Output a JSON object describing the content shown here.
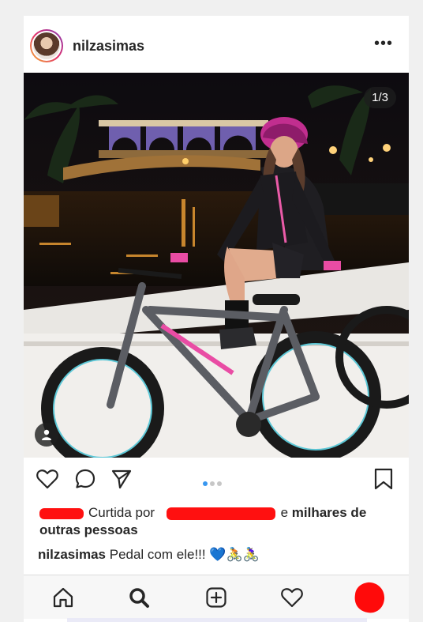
{
  "post": {
    "username": "nilzasimas",
    "more_label": "•••",
    "counter": "1/3",
    "carousel_dots": 3,
    "active_dot": 1
  },
  "likes": {
    "prefix": "Curtida por",
    "connector": "e",
    "suffix_bold": "milhares de outras pessoas"
  },
  "caption": {
    "username": "nilzasimas",
    "text": "Pedal com ele!!! 💙🚴🚴‍♀️"
  },
  "icons": {
    "like": "heart-icon",
    "comment": "comment-icon",
    "share": "send-icon",
    "save": "bookmark-icon",
    "home": "home-icon",
    "search": "search-icon",
    "new_post": "plus-square-icon",
    "activity": "heart-icon",
    "profile": "avatar-icon"
  },
  "colors": {
    "accent_blue": "#3897f0",
    "redaction": "#ff1010",
    "text": "#262626"
  }
}
